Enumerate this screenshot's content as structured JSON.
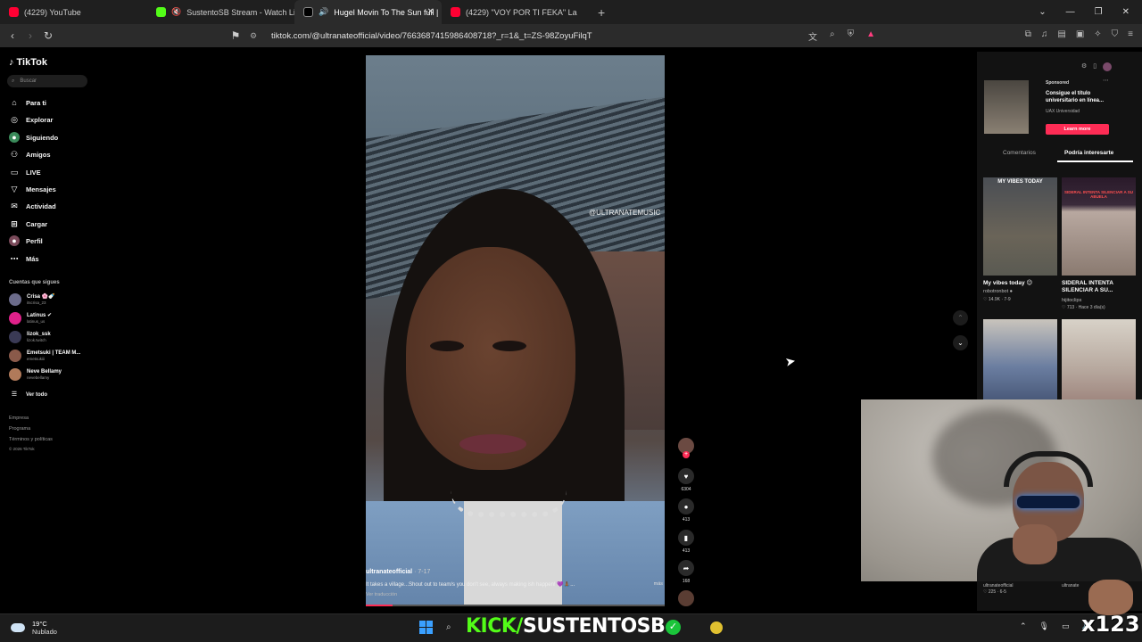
{
  "browser": {
    "tabs": [
      {
        "title": "(4229) YouTube",
        "color": "#ff0033",
        "active": false
      },
      {
        "title": "SustentoSB Stream - Watch Live",
        "color": "#53fc18",
        "active": false
      },
      {
        "title": "Hugel Movin To The Sun full |",
        "color": "#ffffff",
        "active": true
      },
      {
        "title": "(4229) \"VOY POR TI FEKA\" La",
        "color": "#ff0033",
        "active": false
      }
    ],
    "url": "tiktok.com/@ultranateofficial/video/7663687415986408718?_r=1&_t=ZS-98ZoyuFilqT"
  },
  "tiktok": {
    "logo": "TikTok",
    "search_placeholder": "Buscar",
    "nav": [
      {
        "label": "Para ti",
        "icon": "home-icon"
      },
      {
        "label": "Explorar",
        "icon": "compass-icon"
      },
      {
        "label": "Siguiendo",
        "icon": "following-icon"
      },
      {
        "label": "Amigos",
        "icon": "friends-icon"
      },
      {
        "label": "LIVE",
        "icon": "live-icon"
      },
      {
        "label": "Mensajes",
        "icon": "message-icon"
      },
      {
        "label": "Actividad",
        "icon": "activity-icon"
      },
      {
        "label": "Cargar",
        "icon": "upload-icon"
      },
      {
        "label": "Perfil",
        "icon": "profile-icon"
      },
      {
        "label": "Más",
        "icon": "more-icon"
      }
    ],
    "following_header": "Cuentas que sigues",
    "following": [
      {
        "name": "Crisa 🌸🍼",
        "handle": "itscrisa_23",
        "color": "#6b6b8a"
      },
      {
        "name": "Latinus ✔",
        "handle": "latinus_us",
        "color": "#e0218a"
      },
      {
        "name": "lizok_ssk",
        "handle": "lizok.twitch",
        "color": "#3a3a55"
      },
      {
        "name": "Emetsuki | TEAM M...",
        "handle": "emetsukiii",
        "color": "#8a5a4a"
      },
      {
        "name": "Neve Bellamy",
        "handle": "nevebellamy",
        "color": "#b07a5a"
      }
    ],
    "see_all": "Ver todo",
    "footer": [
      "Empresa",
      "Programa",
      "Términos y políticas",
      "© 2026 TikTok"
    ]
  },
  "video": {
    "watermark": "@ULTRANATEMUSIC",
    "author": "ultranateofficial",
    "date": "· 7-17",
    "caption": "It takes a village...Shout out to team/s you don't see, always making ish happen! 💜🙏🏾...",
    "more": "más",
    "translate": "Ver traducción",
    "progress": 0.09,
    "likes": "6304",
    "comments": "413",
    "saves": "413",
    "shares": "168"
  },
  "panel": {
    "ad": {
      "sponsored": "Sponsored",
      "title": "Consigue el título universitario en línea...",
      "brand": "UAX Universidad",
      "cta": "Learn more"
    },
    "tabs": {
      "comments": "Comentarios",
      "suggested": "Podría interesarte"
    },
    "related": [
      {
        "overlay": "MY VIBES TODAY",
        "title": "My vibes today 😉",
        "author": "robotronbot ●",
        "stats": "♡ 14.9K · 7-9"
      },
      {
        "overlay": "SIDERAL INTENTA SILENCIAR A SU ABUELA",
        "title": "SIDERAL INTENTA SILENCIAR A SU...",
        "author": "hijitoclips",
        "stats": "♡ 713 · Hace 3 día(s)"
      }
    ],
    "bottom": [
      {
        "author": "ultranateofficial",
        "stats": "♡ 225 · 6-5"
      },
      {
        "author": "ultranate",
        "stats": ""
      }
    ]
  },
  "taskbar": {
    "temp": "19°C",
    "weather": "Nublado",
    "banner_kick": "KICK/",
    "banner_name": "SUSTENTOSB",
    "corner": "x123"
  }
}
